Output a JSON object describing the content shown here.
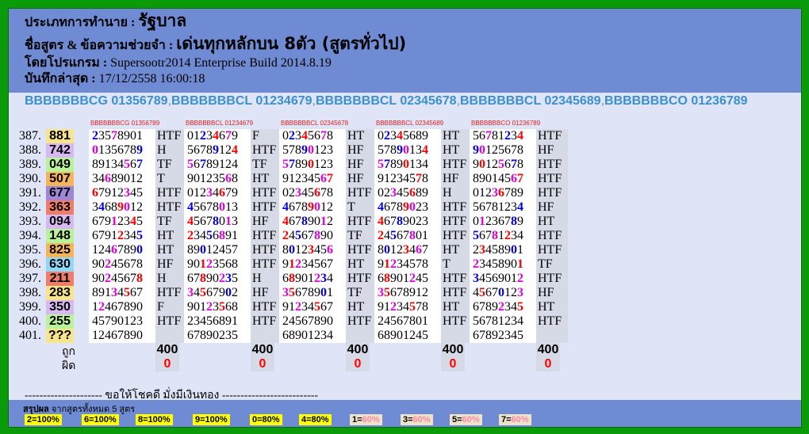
{
  "header": {
    "type_label": "ประเภทการทำนาย :",
    "type_value": "รัฐบาล",
    "formula_label": "ชื่อสูตร & ข้อความช่วยจำ :",
    "formula_value": "เด่นทุกหลักบน 8ตัว (สูตรทั่วไป)",
    "program_label": "โดยโปรแกรม :",
    "program_value": "Supersootr2014 Enterprise Build 2014.8.19",
    "saved_label": "บันทึกล่าสุด :",
    "saved_value": "17/12/2558 16:00:18"
  },
  "formulas": [
    "BBBBBBBCG 01356789",
    "BBBBBBBCL 01234679",
    "BBBBBBBCL 02345678",
    "BBBBBBBCL 02345689",
    "BBBBBBBCO 01236789"
  ],
  "colors": {
    "res_yellow": "#f8e58b",
    "res_pink": "#f3a6c4",
    "res_green": "#b8f29a",
    "res_orange": "#f6b45a",
    "res_purple": "#9f86d6",
    "res_red": "#f07c6a",
    "res_cyan": "#8fd8f6",
    "res_lavender": "#d8b8f0",
    "res_salmon": "#f0a0a0"
  },
  "rows": [
    {
      "no": "387.",
      "res": "881",
      "color": "#f8e58b"
    },
    {
      "no": "388.",
      "res": "742",
      "color": "#d8b8f0"
    },
    {
      "no": "389.",
      "res": "049",
      "color": "#b8f29a"
    },
    {
      "no": "390.",
      "res": "507",
      "color": "#f6b45a"
    },
    {
      "no": "391.",
      "res": "677",
      "color": "#9f86d6"
    },
    {
      "no": "392.",
      "res": "363",
      "color": "#f07c6a"
    },
    {
      "no": "393.",
      "res": "094",
      "color": "#d8b8f0"
    },
    {
      "no": "394.",
      "res": "148",
      "color": "#b8f29a"
    },
    {
      "no": "395.",
      "res": "825",
      "color": "#f6b45a"
    },
    {
      "no": "396.",
      "res": "630",
      "color": "#8fd8f6"
    },
    {
      "no": "397.",
      "res": "211",
      "color": "#f07c6a"
    },
    {
      "no": "398.",
      "res": "283",
      "color": "#f8e58b"
    },
    {
      "no": "399.",
      "res": "350",
      "color": "#d8b8f0"
    },
    {
      "no": "400.",
      "res": "255",
      "color": "#b8f29a"
    },
    {
      "no": "401.",
      "res": "???",
      "color": "#f8e58b"
    }
  ],
  "columns": [
    {
      "head": "BBBBBBBCG 01356789",
      "total": "400",
      "wrong": "0",
      "cells": [
        [
          "23578901",
          "HTF"
        ],
        [
          "01356789",
          "H"
        ],
        [
          "89134567",
          "TF"
        ],
        [
          "34689012",
          "T"
        ],
        [
          "67912345",
          "HTF"
        ],
        [
          "34689012",
          "HTF"
        ],
        [
          "67912345",
          "TF"
        ],
        [
          "67912345",
          "HT"
        ],
        [
          "12467890",
          "HT"
        ],
        [
          "90245678",
          "HF"
        ],
        [
          "90245678",
          "H"
        ],
        [
          "89134567",
          "HTF"
        ],
        [
          "12467890",
          "F"
        ],
        [
          "45790123",
          "HTF"
        ],
        [
          "12467890",
          ""
        ]
      ]
    },
    {
      "head": "BBBBBBBCL 01234679",
      "total": "400",
      "wrong": "0",
      "cells": [
        [
          "01234679",
          "F"
        ],
        [
          "56789124",
          "HTF"
        ],
        [
          "56789124",
          "TF"
        ],
        [
          "90123568",
          "HT"
        ],
        [
          "01234679",
          "HTF"
        ],
        [
          "45678013",
          "HTF"
        ],
        [
          "45678013",
          "HF"
        ],
        [
          "23456891",
          "HTF"
        ],
        [
          "89012457",
          "HTF"
        ],
        [
          "90123568",
          "HTF"
        ],
        [
          "67890235",
          "H"
        ],
        [
          "34567902",
          "HF"
        ],
        [
          "90123568",
          "HTF"
        ],
        [
          "23456891",
          "HTF"
        ],
        [
          "67890235",
          ""
        ]
      ]
    },
    {
      "head": "BBBBBBBCL 02345678",
      "total": "400",
      "wrong": "0",
      "cells": [
        [
          "02345678",
          "HT"
        ],
        [
          "57890123",
          "HF"
        ],
        [
          "57890123",
          "HF"
        ],
        [
          "91234567",
          "HF"
        ],
        [
          "02345678",
          "HTF"
        ],
        [
          "46789012",
          "T"
        ],
        [
          "46789012",
          "HTF"
        ],
        [
          "24567890",
          "TF"
        ],
        [
          "80123456",
          "HTF"
        ],
        [
          "91234567",
          "HT"
        ],
        [
          "68901234",
          "HTF"
        ],
        [
          "35678901",
          "TF"
        ],
        [
          "91234567",
          "HT"
        ],
        [
          "24567890",
          "HTF"
        ],
        [
          "68901234",
          ""
        ]
      ]
    },
    {
      "head": "BBBBBBBCL 02345689",
      "total": "400",
      "wrong": "0",
      "cells": [
        [
          "02345689",
          "HT"
        ],
        [
          "57890134",
          "HT"
        ],
        [
          "57890134",
          "HTF"
        ],
        [
          "91234578",
          "HF"
        ],
        [
          "02345689",
          "H"
        ],
        [
          "46789023",
          "HTF"
        ],
        [
          "46789023",
          "HTF"
        ],
        [
          "24567801",
          "HTF"
        ],
        [
          "80123467",
          "HT"
        ],
        [
          "91234578",
          "T"
        ],
        [
          "68901245",
          "HTF"
        ],
        [
          "35678912",
          "HTF"
        ],
        [
          "91234578",
          "HT"
        ],
        [
          "24567801",
          "HTF"
        ],
        [
          "68901245",
          ""
        ]
      ]
    },
    {
      "head": "BBBBBBBCO 01236789",
      "total": "400",
      "wrong": "0",
      "cells": [
        [
          "56781234",
          "HTF"
        ],
        [
          "90125678",
          "HF"
        ],
        [
          "90125678",
          "HTF"
        ],
        [
          "89014567",
          "HTF"
        ],
        [
          "01236789",
          "HTF"
        ],
        [
          "56781234",
          "HF"
        ],
        [
          "01236789",
          "HT"
        ],
        [
          "56781234",
          "HTF"
        ],
        [
          "23458901",
          "HTF"
        ],
        [
          "23458901",
          "TF"
        ],
        [
          "34569012",
          "HTF"
        ],
        [
          "45670123",
          "HF"
        ],
        [
          "67892345",
          "HT"
        ],
        [
          "56781234",
          "HTF"
        ],
        [
          "67892345",
          ""
        ]
      ]
    }
  ],
  "labels": {
    "correct": "ถูก",
    "wrong": "ผิด"
  },
  "separator": "--------------------- ขอให้โชคดี มั่งมีเงินทอง --------------------------",
  "summary": {
    "title_bold": "สรุปผล",
    "title_rest": " จากสูตรทั้งหมด 5 สูตร",
    "badges": [
      {
        "k": "2",
        "p": "100%",
        "win": true
      },
      {
        "k": "6",
        "p": "100%",
        "win": true
      },
      {
        "k": "8",
        "p": "100%",
        "win": true
      },
      {
        "k": "9",
        "p": "100%",
        "win": true
      },
      {
        "k": "0",
        "p": "80%",
        "win": true
      },
      {
        "k": "4",
        "p": "80%",
        "win": true
      },
      {
        "k": "1",
        "p": "60%",
        "win": false
      },
      {
        "k": "3",
        "p": "60%",
        "win": false
      },
      {
        "k": "5",
        "p": "60%",
        "win": false
      },
      {
        "k": "7",
        "p": "60%",
        "win": false
      }
    ]
  }
}
